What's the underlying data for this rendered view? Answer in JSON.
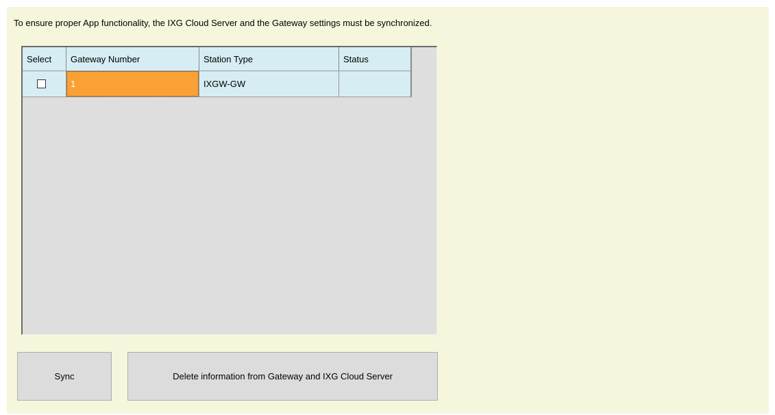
{
  "instruction": "To ensure proper App functionality, the IXG Cloud Server and the Gateway settings must be synchronized.",
  "table": {
    "columns": [
      "Select",
      "Gateway Number",
      "Station Type",
      "Status"
    ],
    "rows": [
      {
        "selected": false,
        "gateway_number": "1",
        "station_type": "IXGW-GW",
        "status": ""
      }
    ]
  },
  "buttons": {
    "sync_label": "Sync",
    "delete_label": "Delete information from Gateway and IXG Cloud Server"
  },
  "colors": {
    "panel_bg": "#f6f6dc",
    "grid_bg": "#dedede",
    "header_bg": "#d6edf3",
    "selected_cell_bg": "#fba034"
  }
}
